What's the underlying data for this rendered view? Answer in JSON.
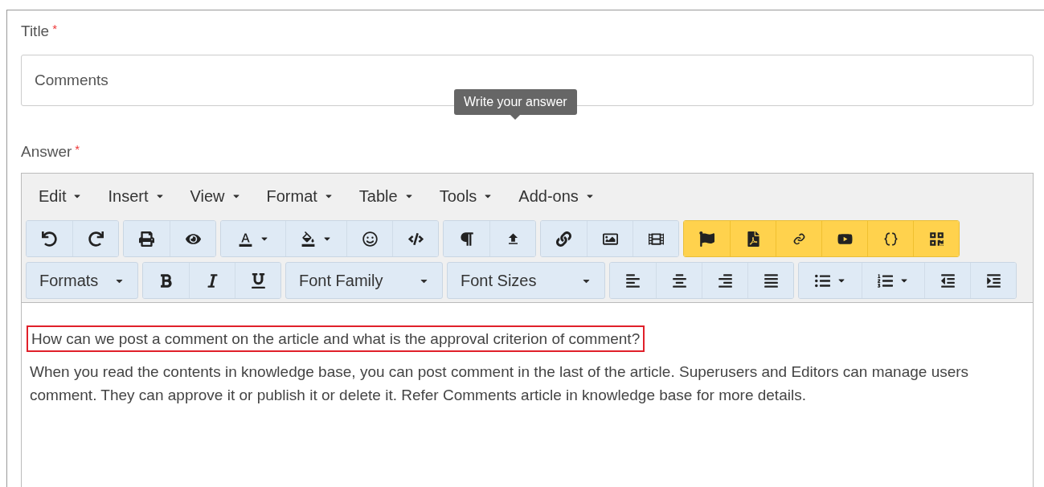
{
  "title_field": {
    "label": "Title",
    "required_mark": "*",
    "value": "Comments"
  },
  "tooltip": {
    "text": "Write your answer"
  },
  "answer": {
    "label": "Answer",
    "required_mark": "*"
  },
  "editor": {
    "menu": [
      {
        "label": "Edit"
      },
      {
        "label": "Insert"
      },
      {
        "label": "View"
      },
      {
        "label": "Format"
      },
      {
        "label": "Table"
      },
      {
        "label": "Tools"
      },
      {
        "label": "Add-ons"
      }
    ],
    "dropdowns": [
      {
        "label": "Formats"
      },
      {
        "label": "Font Family"
      },
      {
        "label": "Font Sizes"
      }
    ],
    "paragraphs": [
      {
        "text": "How can we post a comment on the article and what is the approval criterion of comment?",
        "highlighted": true
      },
      {
        "text": "When you read the contents in knowledge base, you can post comment in the last of the article. Superusers and Editors can manage users comment. They can approve it or publish it or delete it. Refer Comments article in knowledge base for more details.",
        "highlighted": false
      }
    ]
  }
}
